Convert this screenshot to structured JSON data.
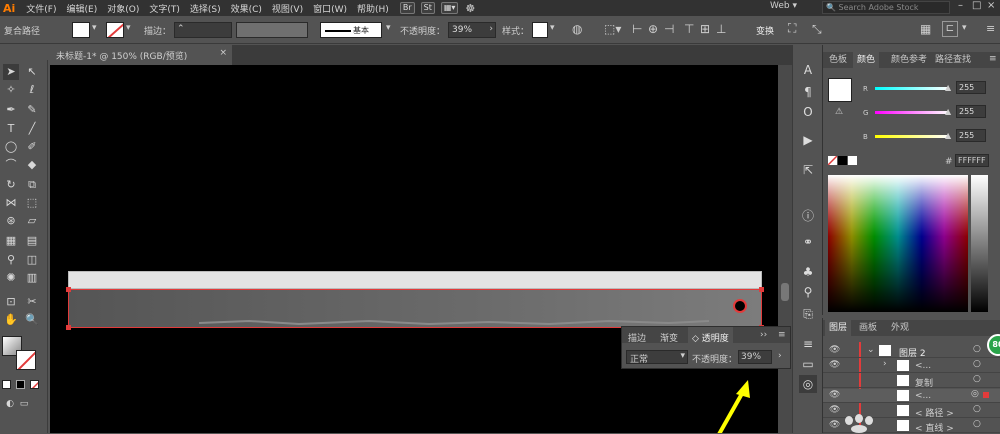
{
  "app": {
    "logo": "Ai"
  },
  "menu": [
    "文件(F)",
    "编辑(E)",
    "对象(O)",
    "文字(T)",
    "选择(S)",
    "效果(C)",
    "视图(V)",
    "窗口(W)",
    "帮助(H)"
  ],
  "menu_badges": [
    "Br",
    "St"
  ],
  "workspace": "Web",
  "search_placeholder": "Search Adobe Stock",
  "control": {
    "selection": "复合路径",
    "stroke_label": "描边：",
    "brush": "基本",
    "opacity_label": "不透明度：",
    "opacity": "39%",
    "style_label": "样式：",
    "transform_label": "变换"
  },
  "document_tab": {
    "title": "未标题-1* @ 150% (RGB/预览)",
    "close": "×"
  },
  "color_panel": {
    "tabs": [
      "色板",
      "颜色",
      "颜色参考",
      "路径查找"
    ],
    "channels": [
      {
        "label": "R",
        "value": "255"
      },
      {
        "label": "G",
        "value": "255"
      },
      {
        "label": "B",
        "value": "255"
      }
    ],
    "hex_label": "#",
    "hex": "FFFFFF"
  },
  "layers_panel": {
    "tabs": [
      "图层",
      "画板",
      "外观"
    ],
    "rows": [
      "图层 2",
      "<...",
      "复制",
      "<...",
      "< 路径 >",
      "< 直线 >"
    ]
  },
  "transparency_panel": {
    "tabs": [
      "描边",
      "渐变",
      "透明度"
    ],
    "blend": "正常",
    "opacity_label": "不透明度：",
    "opacity": "39%"
  },
  "badge": "80",
  "colors": {
    "accent": "#ff7c00",
    "selection_red": "#e23b3b",
    "arrow": "#ffff00",
    "badge": "#2aa44a"
  }
}
